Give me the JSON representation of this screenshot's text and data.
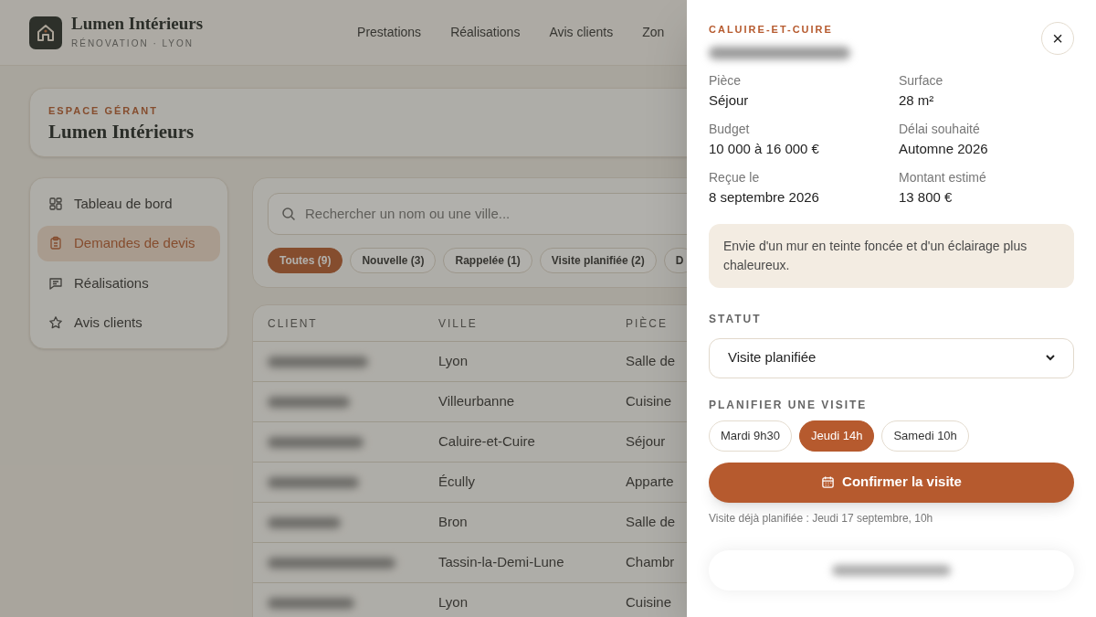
{
  "brand": {
    "name": "Lumen Intérieurs",
    "tagline": "RÉNOVATION · LYON"
  },
  "nav": [
    "Prestations",
    "Réalisations",
    "Avis clients",
    "Zon"
  ],
  "space": {
    "eyebrow": "ESPACE GÉRANT",
    "title": "Lumen Intérieurs"
  },
  "sidebar": {
    "items": [
      {
        "label": "Tableau de bord",
        "selected": false
      },
      {
        "label": "Demandes de devis",
        "selected": true
      },
      {
        "label": "Réalisations",
        "selected": false
      },
      {
        "label": "Avis clients",
        "selected": false
      }
    ]
  },
  "search": {
    "placeholder": "Rechercher un nom ou une ville..."
  },
  "filters": [
    {
      "label": "Toutes (9)",
      "selected": true
    },
    {
      "label": "Nouvelle (3)",
      "selected": false
    },
    {
      "label": "Rappelée (1)",
      "selected": false
    },
    {
      "label": "Visite planifiée (2)",
      "selected": false
    },
    {
      "label": "D",
      "selected": false
    }
  ],
  "table": {
    "columns": [
      "CLIENT",
      "VILLE",
      "PIÈCE"
    ],
    "rows": [
      {
        "ville": "Lyon",
        "piece": "Salle de"
      },
      {
        "ville": "Villeurbanne",
        "piece": "Cuisine"
      },
      {
        "ville": "Caluire-et-Cuire",
        "piece": "Séjour"
      },
      {
        "ville": "Écully",
        "piece": "Apparte"
      },
      {
        "ville": "Bron",
        "piece": "Salle de"
      },
      {
        "ville": "Tassin-la-Demi-Lune",
        "piece": "Chambr"
      },
      {
        "ville": "Lyon",
        "piece": "Cuisine"
      }
    ]
  },
  "drawer": {
    "city": "CALUIRE-ET-CUIRE",
    "close": "×",
    "fields": [
      {
        "label": "Pièce",
        "value": "Séjour"
      },
      {
        "label": "Surface",
        "value": "28 m²"
      },
      {
        "label": "Budget",
        "value": "10 000 à 16 000 €"
      },
      {
        "label": "Délai souhaité",
        "value": "Automne 2026"
      },
      {
        "label": "Reçue le",
        "value": "8 septembre 2026"
      },
      {
        "label": "Montant estimé",
        "value": "13 800 €"
      }
    ],
    "note": "Envie d'un mur en teinte foncée et d'un éclairage plus chaleureux.",
    "status_label": "STATUT",
    "status_value": "Visite planifiée",
    "visit_label": "PLANIFIER UNE VISITE",
    "slots": [
      {
        "label": "Mardi 9h30",
        "selected": false
      },
      {
        "label": "Jeudi 14h",
        "selected": true
      },
      {
        "label": "Samedi 10h",
        "selected": false
      }
    ],
    "confirm": "Confirmer la visite",
    "scheduled": "Visite déjà planifiée : Jeudi 17 septembre, 10h"
  }
}
